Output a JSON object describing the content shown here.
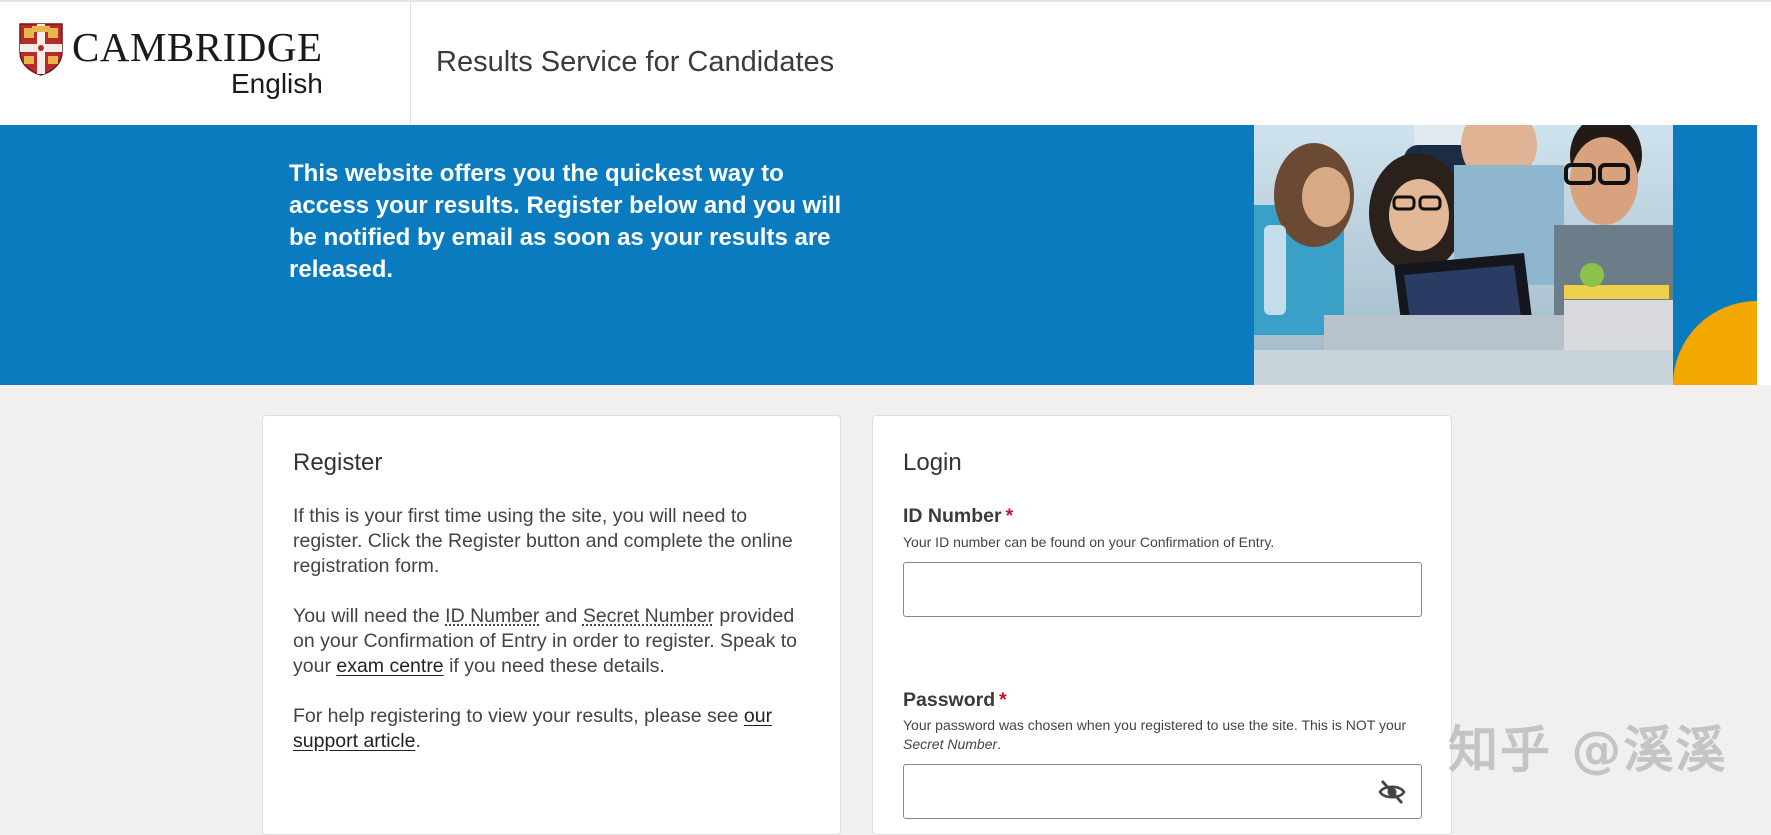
{
  "header": {
    "logo_word": "CAMBRIDGE",
    "logo_sub": "English",
    "site_title": "Results Service for Candidates"
  },
  "hero": {
    "text": "This website offers you the quickest way to access your results. Register below and you will be notified by email as soon as your results are released.",
    "accent_color": "#f3a800",
    "background_color": "#0b7bbf"
  },
  "register": {
    "title": "Register",
    "p1": "If this is your first time using the site, you will need to register. Click the Register button and complete the online registration form.",
    "p2_a": "You will need the ",
    "p2_id": "ID Number",
    "p2_b": " and ",
    "p2_secret": "Secret Number",
    "p2_c": " provided on your Confirmation of Entry in order to register. Speak to your ",
    "p2_link": "exam centre",
    "p2_d": " if you need these details.",
    "p3_a": "For help registering to view your results, please see ",
    "p3_link": "our support article",
    "p3_b": "."
  },
  "login": {
    "title": "Login",
    "id_label": "ID Number",
    "id_required": "*",
    "id_help": "Your ID number can be found on your Confirmation of Entry.",
    "id_value": "",
    "password_label": "Password",
    "password_required": "*",
    "password_help_a": "Your password was chosen when you registered to use the site. This is NOT your ",
    "password_help_em": "Secret Number",
    "password_help_b": ".",
    "password_value": "",
    "toggle_icon": "eye-slash-icon"
  },
  "watermark": "知乎 @溪溪"
}
